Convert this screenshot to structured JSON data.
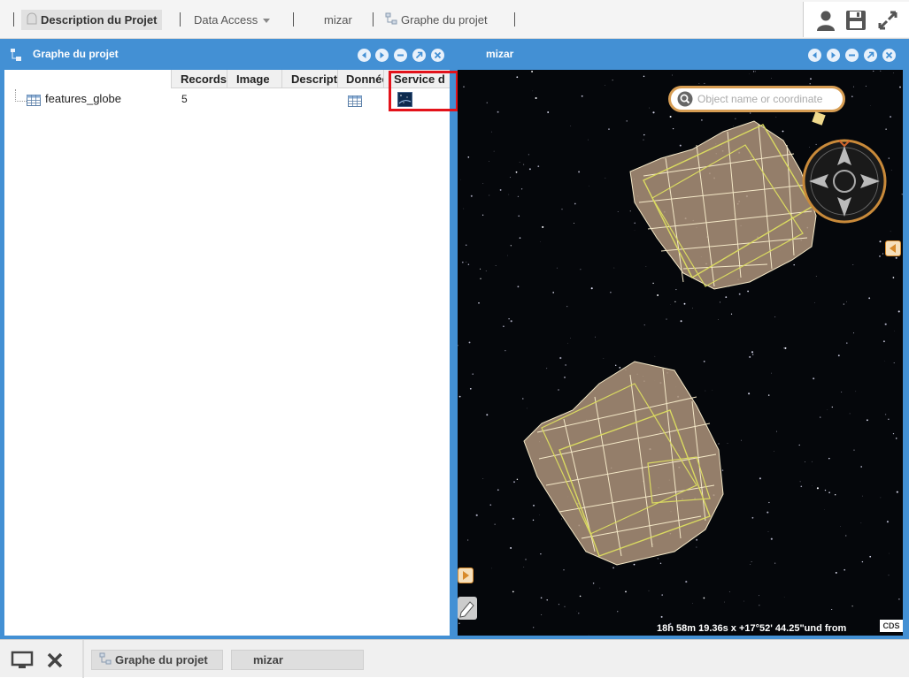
{
  "topbar": {
    "tabs": [
      {
        "label": "Description du Projet",
        "active": true,
        "icon": "description-icon"
      },
      {
        "label": "Data Access",
        "active": false,
        "icon": "dropdown-caret-icon"
      },
      {
        "label": "mizar",
        "active": false
      },
      {
        "label": "Graphe du projet",
        "active": false,
        "icon": "graph-icon"
      }
    ],
    "tools": [
      "user-icon",
      "save-icon",
      "fullscreen-icon"
    ]
  },
  "left_panel": {
    "title": "Graphe du projet",
    "columns": [
      "Records",
      "Image",
      "Descript",
      "Donnée",
      "Service d"
    ],
    "rows": [
      {
        "name": "features_globe",
        "records": "5",
        "icons": [
          "table-icon",
          "sky-service-icon"
        ]
      }
    ]
  },
  "right_panel": {
    "title": "mizar",
    "search_placeholder": "Object name or coordinate",
    "coords": "18h 58m 19.36s x +17°52' 44.25\"und from",
    "cds_logo": "CDS"
  },
  "taskbar": {
    "items": [
      "Graphe du projet",
      "mizar"
    ],
    "icons": [
      "desktop-icon",
      "close-all-icon"
    ]
  },
  "colors": {
    "workspace_blue": "#4390d4",
    "highlight_red": "#e3121a",
    "footprint": "#a99077",
    "footprint_line": "#f5e9c8",
    "compass_ring": "#c98a3a"
  }
}
